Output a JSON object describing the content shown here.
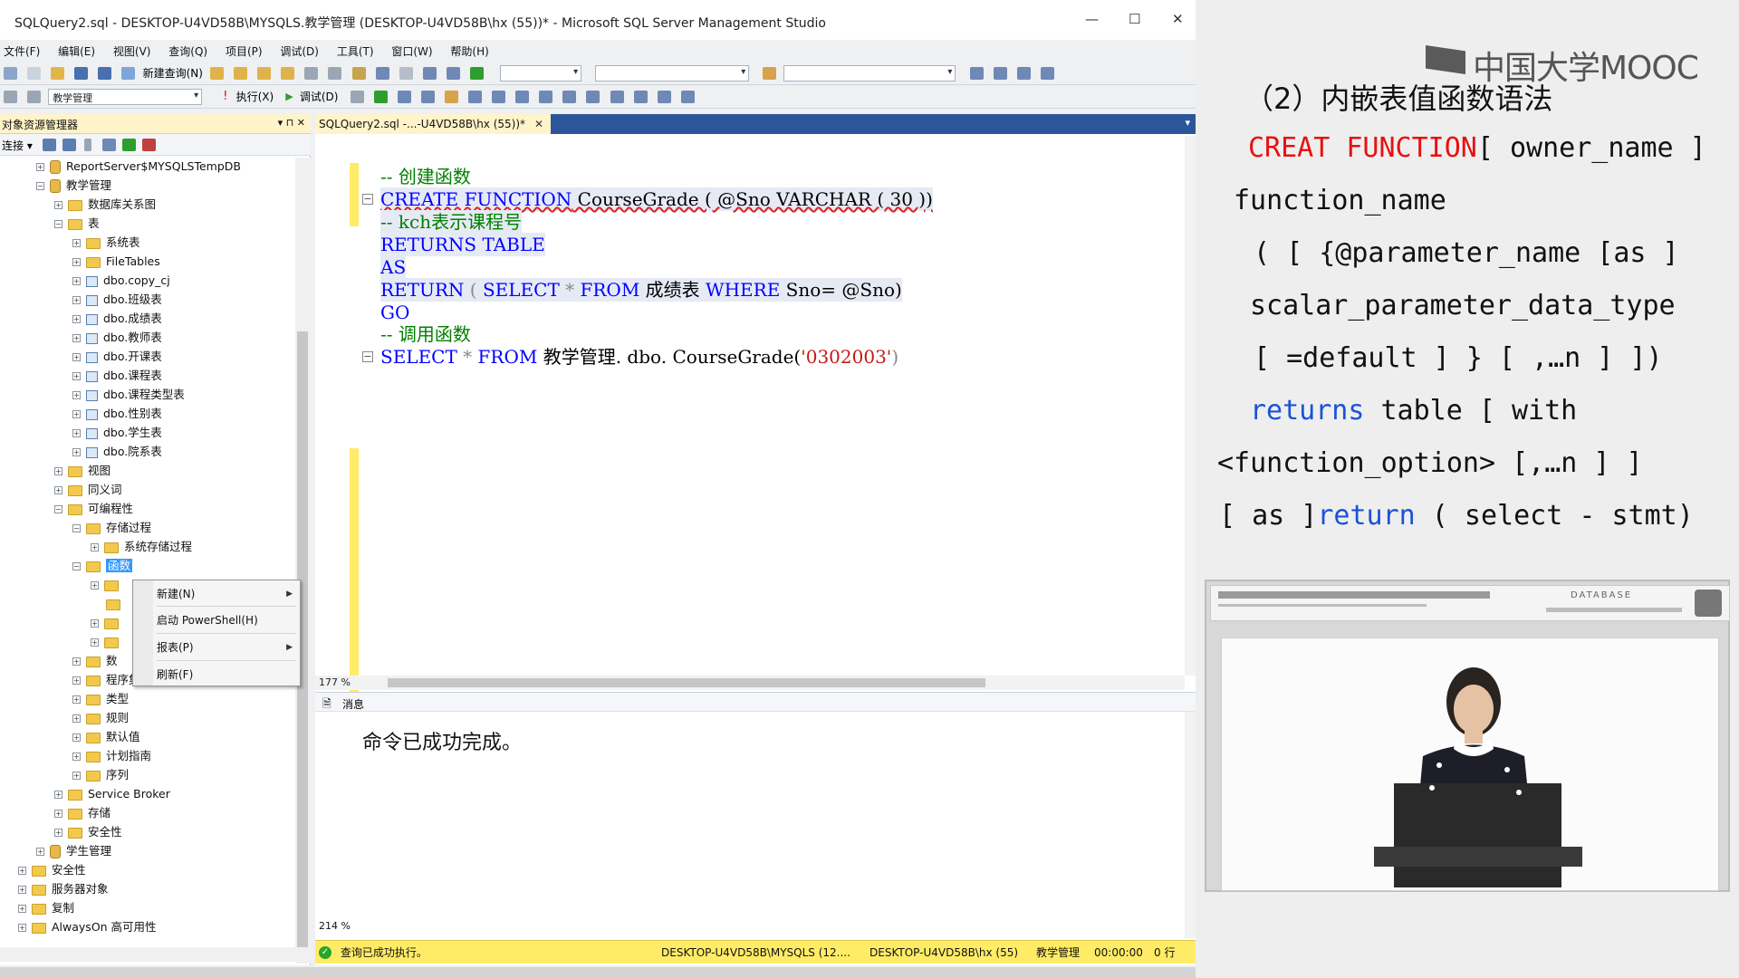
{
  "window": {
    "title": "SQLQuery2.sql - DESKTOP-U4VD58B\\MYSQLS.教学管理 (DESKTOP-U4VD58B\\hx (55))* - Microsoft SQL Server Management Studio",
    "min": "—",
    "max": "☐",
    "close": "✕"
  },
  "menu": [
    "文件(F)",
    "编辑(E)",
    "视图(V)",
    "查询(Q)",
    "项目(P)",
    "调试(D)",
    "工具(T)",
    "窗口(W)",
    "帮助(H)"
  ],
  "toolbar": {
    "new_query": "新建查询(N)",
    "db_combo": "教学管理",
    "execute": "执行(X)",
    "debug": "调试(D)"
  },
  "object_explorer": {
    "title": "对象资源管理器",
    "pin": "▾ ⊓ ✕",
    "connect": "连接 ▾",
    "tree": [
      "ReportServer$MYSQLSTempDB",
      "教学管理",
      "数据库关系图",
      "表",
      "系统表",
      "FileTables",
      "dbo.copy_cj",
      "dbo.班级表",
      "dbo.成绩表",
      "dbo.教师表",
      "dbo.开课表",
      "dbo.课程表",
      "dbo.课程类型表",
      "dbo.性别表",
      "dbo.学生表",
      "dbo.院系表",
      "视图",
      "同义词",
      "可编程性",
      "存储过程",
      "系统存储过程",
      "函数",
      "",
      "",
      "",
      "",
      "数",
      "程序集",
      "类型",
      "规则",
      "默认值",
      "计划指南",
      "序列",
      "Service Broker",
      "存储",
      "安全性",
      "学生管理",
      "安全性",
      "服务器对象",
      "复制",
      "AlwaysOn 高可用性"
    ]
  },
  "context_menu": {
    "items": [
      "新建(N)",
      "启动 PowerShell(H)",
      "报表(P)",
      "刷新(F)"
    ]
  },
  "editor": {
    "tab": "SQLQuery2.sql -...-U4VD58B\\hx (55))*",
    "tab_close": "✕",
    "lines": {
      "l1": "-- 创建函数",
      "l2a": "CREATE FUNCTION",
      "l2b": " CourseGrade ( @Sno VARCHAR ( 30 ))",
      "l3": "-- kch表示课程号",
      "l4": "RETURNS  TABLE",
      "l5": "AS",
      "l6a": "RETURN",
      "l6b": " ( ",
      "l6c": "SELECT",
      "l6d": " * ",
      "l6e": "FROM",
      "l6f": " 成绩表 ",
      "l6g": "WHERE",
      "l6h": " Sno= @Sno)",
      "l7": "GO",
      "l8": "-- 调用函数",
      "l9a": "SELECT",
      "l9b": " * ",
      "l9c": "FROM",
      "l9d": " 教学管理. dbo. CourseGrade(",
      "l9e": "'0302003'",
      "l9f": ")"
    },
    "zoom1": "177 %",
    "messages_tab": "消息",
    "message": "命令已成功完成。",
    "zoom2": "214 %"
  },
  "status": {
    "text": "查询已成功执行。",
    "server": "DESKTOP-U4VD58B\\MYSQLS (12....",
    "user": "DESKTOP-U4VD58B\\hx (55)",
    "db": "教学管理",
    "time": "00:00:00",
    "rows": "0 行"
  },
  "slide": {
    "logo": "中国大学MOOC",
    "heading": "（2）内嵌表值函数语法",
    "s1a": "CREAT FUNCTION",
    "s1b": "[ owner_name ]",
    "s2": "function_name",
    "s3": "( [ {@parameter_name [as ]",
    "s4": "scalar_parameter_data_type",
    "s5": "[ =default ] }  [ ,…n ] ])",
    "s6a": "returns",
    "s6b": "  table [ with",
    "s7": "<function_option> [,…n ] ]",
    "s8a": "[ as ]",
    "s8b": "return",
    "s8c": "  ( select - stmt)",
    "database_label": "DATABASE"
  }
}
